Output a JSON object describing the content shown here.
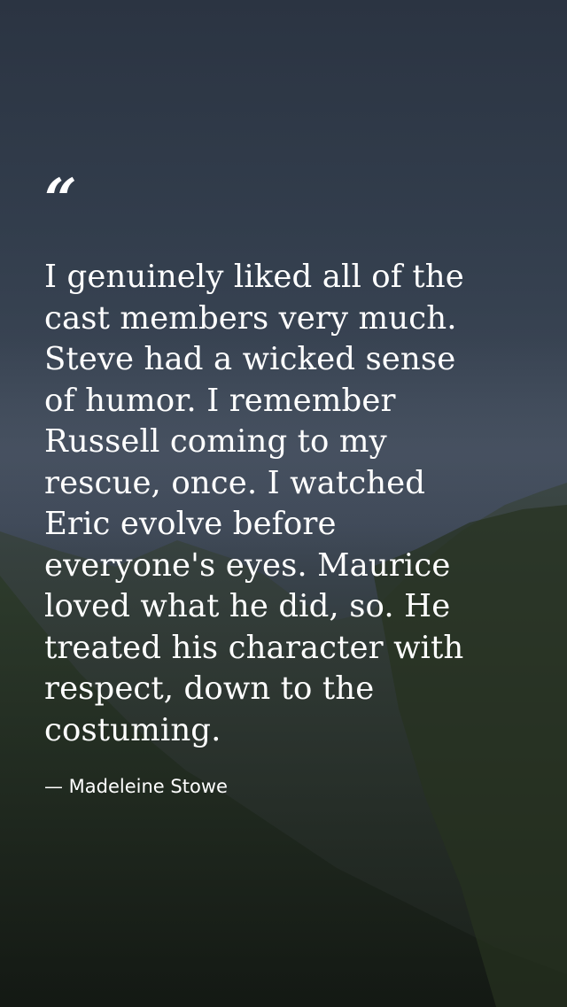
{
  "quote": {
    "mark": "“",
    "text": "I genuinely liked all of the\ncast members very much.\nSteve had a wicked sense\nof humor. I remember\nRussell coming to my\nrescue, once. I watched\nEric evolve before\neveryone's eyes. Maurice\nloved what he did, so. He\ntreated his character with\nrespect, down to the\ncostuming.",
    "author": "— Madeleine Stowe"
  },
  "colors": {
    "text": "#ffffff",
    "sky": "#323d4c",
    "mountain": "#1e261f"
  }
}
